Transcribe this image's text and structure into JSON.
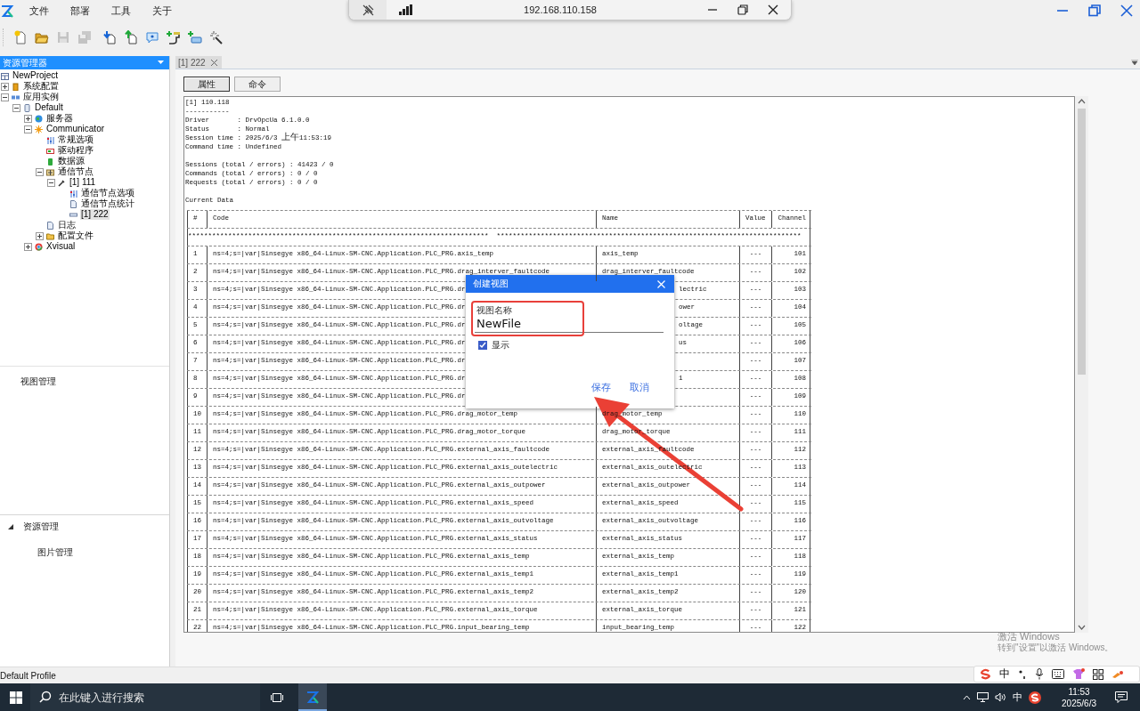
{
  "menu": [
    "文件",
    "部署",
    "工具",
    "关于"
  ],
  "remote_bar": {
    "address": "192.168.110.158"
  },
  "toolbar": [
    {
      "kind": "new",
      "disabled": false
    },
    {
      "kind": "open",
      "disabled": false
    },
    {
      "kind": "save",
      "disabled": true
    },
    {
      "kind": "save_all",
      "disabled": true
    },
    {
      "kind": "import",
      "disabled": false
    },
    {
      "kind": "export",
      "disabled": false
    },
    {
      "kind": "help",
      "disabled": false
    },
    {
      "kind": "connect",
      "disabled": false
    },
    {
      "kind": "add_device",
      "disabled": false
    },
    {
      "kind": "tool",
      "disabled": false
    }
  ],
  "sidebar": {
    "title": "资源管理器",
    "tree": [
      {
        "label": "NewProject",
        "kind": "project",
        "selected": false,
        "children": [
          {
            "label": "系统配置",
            "kind": "config",
            "expanded": false,
            "selected": false
          },
          {
            "label": "应用实例",
            "kind": "instances",
            "expanded": true,
            "selected": false,
            "children": [
              {
                "label": "Default",
                "kind": "device",
                "expanded": true,
                "selected": false,
                "children": [
                  {
                    "label": "服务器",
                    "kind": "server",
                    "expanded": false,
                    "selected": false
                  },
                  {
                    "label": "Communicator",
                    "kind": "communicator",
                    "expanded": true,
                    "selected": false,
                    "children": [
                      {
                        "label": "常规选项",
                        "kind": "options",
                        "selected": false
                      },
                      {
                        "label": "驱动程序",
                        "kind": "driver",
                        "selected": false
                      },
                      {
                        "label": "数据源",
                        "kind": "datasource",
                        "selected": false
                      },
                      {
                        "label": "通信节点",
                        "kind": "nodes",
                        "expanded": true,
                        "selected": false,
                        "children": [
                          {
                            "label": "[1] 111",
                            "kind": "channel",
                            "expanded": true,
                            "selected": false,
                            "children": [
                              {
                                "label": "通信节点选项",
                                "kind": "options",
                                "selected": false
                              },
                              {
                                "label": "通信节点统计",
                                "kind": "document",
                                "selected": false
                              },
                              {
                                "label": "[1] 222",
                                "kind": "tag",
                                "selected": true
                              }
                            ]
                          }
                        ]
                      },
                      {
                        "label": "日志",
                        "kind": "document",
                        "selected": false
                      },
                      {
                        "label": "配置文件",
                        "kind": "folder",
                        "expanded": false,
                        "selected": false
                      }
                    ]
                  },
                  {
                    "label": "Xvisual",
                    "kind": "xvisual",
                    "expanded": false,
                    "selected": false
                  }
                ]
              }
            ]
          }
        ]
      }
    ],
    "panels": [
      {
        "label": "视图管理"
      },
      {
        "label": "资源管理",
        "expanded": true,
        "children": [
          {
            "label": "图片管理"
          }
        ]
      }
    ]
  },
  "document": {
    "tabs": [
      {
        "label": "[1] 222",
        "selected": true
      }
    ],
    "view_buttons": [
      {
        "label": "属性",
        "selected": true
      },
      {
        "label": "命令",
        "selected": false
      }
    ],
    "info_blocks": [
      [
        "[1] 110.118",
        "-----------",
        "Driver       : DrvOpcUa 6.1.0.0",
        "Status       : Normal",
        "Session time : 2025/6/3 上午11:53:19",
        "Command time : Undefined"
      ],
      [
        "Sessions (total / errors) : 41423 / 0",
        "Commands (total / errors) : 0 / 0",
        "Requests (total / errors) : 0 / 0"
      ],
      [
        "Current Data"
      ]
    ],
    "table": {
      "columns": [
        "#",
        "Code",
        "Name",
        "Value",
        "Channel"
      ],
      "separator": "***************************************************************************  ****************************************************************************",
      "rows": [
        {
          "index": "1",
          "code": "ns=4;s=|var|Sinsegye x86_64-Linux-SM-CNC.Application.PLC_PRG.axis_temp",
          "name": "axis_temp",
          "value": "---",
          "channel": "101"
        },
        {
          "index": "2",
          "code": "ns=4;s=|var|Sinsegye x86_64-Linux-SM-CNC.Application.PLC_PRG.drag_interver_faultcode",
          "name": "drag_interver_faultcode",
          "value": "---",
          "channel": "102"
        },
        {
          "index": "3",
          "kind": "covered",
          "code": "ns=4;s=|var|Sinsegye x86_64-Linux-SM-CNC.Application.PLC_PRG.dr",
          "name": "lectric",
          "value": "---",
          "channel": "103"
        },
        {
          "index": "4",
          "kind": "covered",
          "code": "ns=4;s=|var|Sinsegye x86_64-Linux-SM-CNC.Application.PLC_PRG.dr",
          "name": "ower",
          "value": "---",
          "channel": "104"
        },
        {
          "index": "5",
          "kind": "covered",
          "code": "ns=4;s=|var|Sinsegye x86_64-Linux-SM-CNC.Application.PLC_PRG.dr",
          "name": "oltage",
          "value": "---",
          "channel": "105"
        },
        {
          "index": "6",
          "kind": "covered",
          "code": "ns=4;s=|var|Sinsegye x86_64-Linux-SM-CNC.Application.PLC_PRG.dr",
          "name": "us",
          "value": "---",
          "channel": "106"
        },
        {
          "index": "7",
          "kind": "covered",
          "code": "ns=4;s=|var|Sinsegye x86_64-Linux-SM-CNC.Application.PLC_PRG.dr",
          "value": "---",
          "channel": "107"
        },
        {
          "index": "8",
          "kind": "covered",
          "code": "ns=4;s=|var|Sinsegye x86_64-Linux-SM-CNC.Application.PLC_PRG.dr",
          "name": "1",
          "value": "---",
          "channel": "108"
        },
        {
          "index": "9",
          "kind": "covered",
          "code": "ns=4;s=|var|Sinsegye x86_64-Linux-SM-CNC.Application.PLC_PRG.dr",
          "value": "---",
          "channel": "109"
        },
        {
          "index": "10",
          "code": "ns=4;s=|var|Sinsegye x86_64-Linux-SM-CNC.Application.PLC_PRG.drag_motor_temp",
          "name": "drag_motor_temp",
          "value": "---",
          "channel": "110"
        },
        {
          "index": "11",
          "code": "ns=4;s=|var|Sinsegye x86_64-Linux-SM-CNC.Application.PLC_PRG.drag_motor_torque",
          "name": "drag_motor_torque",
          "value": "---",
          "channel": "111"
        },
        {
          "index": "12",
          "code": "ns=4;s=|var|Sinsegye x86_64-Linux-SM-CNC.Application.PLC_PRG.external_axis_faultcode",
          "name": "external_axis_faultcode",
          "value": "---",
          "channel": "112"
        },
        {
          "index": "13",
          "code": "ns=4;s=|var|Sinsegye x86_64-Linux-SM-CNC.Application.PLC_PRG.external_axis_outelectric",
          "name": "external_axis_outelectric",
          "value": "---",
          "channel": "113"
        },
        {
          "index": "14",
          "code": "ns=4;s=|var|Sinsegye x86_64-Linux-SM-CNC.Application.PLC_PRG.external_axis_outpower",
          "name": "external_axis_outpower",
          "value": "---",
          "channel": "114"
        },
        {
          "index": "15",
          "code": "ns=4;s=|var|Sinsegye x86_64-Linux-SM-CNC.Application.PLC_PRG.external_axis_speed",
          "name": "external_axis_speed",
          "value": "---",
          "channel": "115"
        },
        {
          "index": "16",
          "code": "ns=4;s=|var|Sinsegye x86_64-Linux-SM-CNC.Application.PLC_PRG.external_axis_outvoltage",
          "name": "external_axis_outvoltage",
          "value": "---",
          "channel": "116"
        },
        {
          "index": "17",
          "code": "ns=4;s=|var|Sinsegye x86_64-Linux-SM-CNC.Application.PLC_PRG.external_axis_status",
          "name": "external_axis_status",
          "value": "---",
          "channel": "117"
        },
        {
          "index": "18",
          "code": "ns=4;s=|var|Sinsegye x86_64-Linux-SM-CNC.Application.PLC_PRG.external_axis_temp",
          "name": "external_axis_temp",
          "value": "---",
          "channel": "118"
        },
        {
          "index": "19",
          "code": "ns=4;s=|var|Sinsegye x86_64-Linux-SM-CNC.Application.PLC_PRG.external_axis_temp1",
          "name": "external_axis_temp1",
          "value": "---",
          "channel": "119"
        },
        {
          "index": "20",
          "code": "ns=4;s=|var|Sinsegye x86_64-Linux-SM-CNC.Application.PLC_PRG.external_axis_temp2",
          "name": "external_axis_temp2",
          "value": "---",
          "channel": "120"
        },
        {
          "index": "21",
          "code": "ns=4;s=|var|Sinsegye x86_64-Linux-SM-CNC.Application.PLC_PRG.external_axis_torque",
          "name": "external_axis_torque",
          "value": "---",
          "channel": "121"
        },
        {
          "index": "22",
          "code": "ns=4;s=|var|Sinsegye x86_64-Linux-SM-CNC.Application.PLC_PRG.input_bearing_temp",
          "name": "input_bearing_temp",
          "value": "---",
          "channel": "122"
        }
      ]
    }
  },
  "dialog": {
    "title": "创建视图",
    "field": {
      "label": "视图名称",
      "value": "NewFile"
    },
    "checkbox": {
      "label": "显示",
      "checked": true
    },
    "buttons": [
      "保存",
      "取消"
    ]
  },
  "annotations": {
    "highlight_box": true,
    "arrow": true
  },
  "status_bar": {
    "text": "Default Profile"
  },
  "activation": {
    "title": "激活 Windows",
    "hint": "转到\"设置\"以激活 Windows。"
  },
  "ime_bar": {
    "mode": "中"
  },
  "taskbar": {
    "search_placeholder": "在此键入进行搜索",
    "ime": "中",
    "time": "11:53",
    "date": "2025/6/3"
  }
}
